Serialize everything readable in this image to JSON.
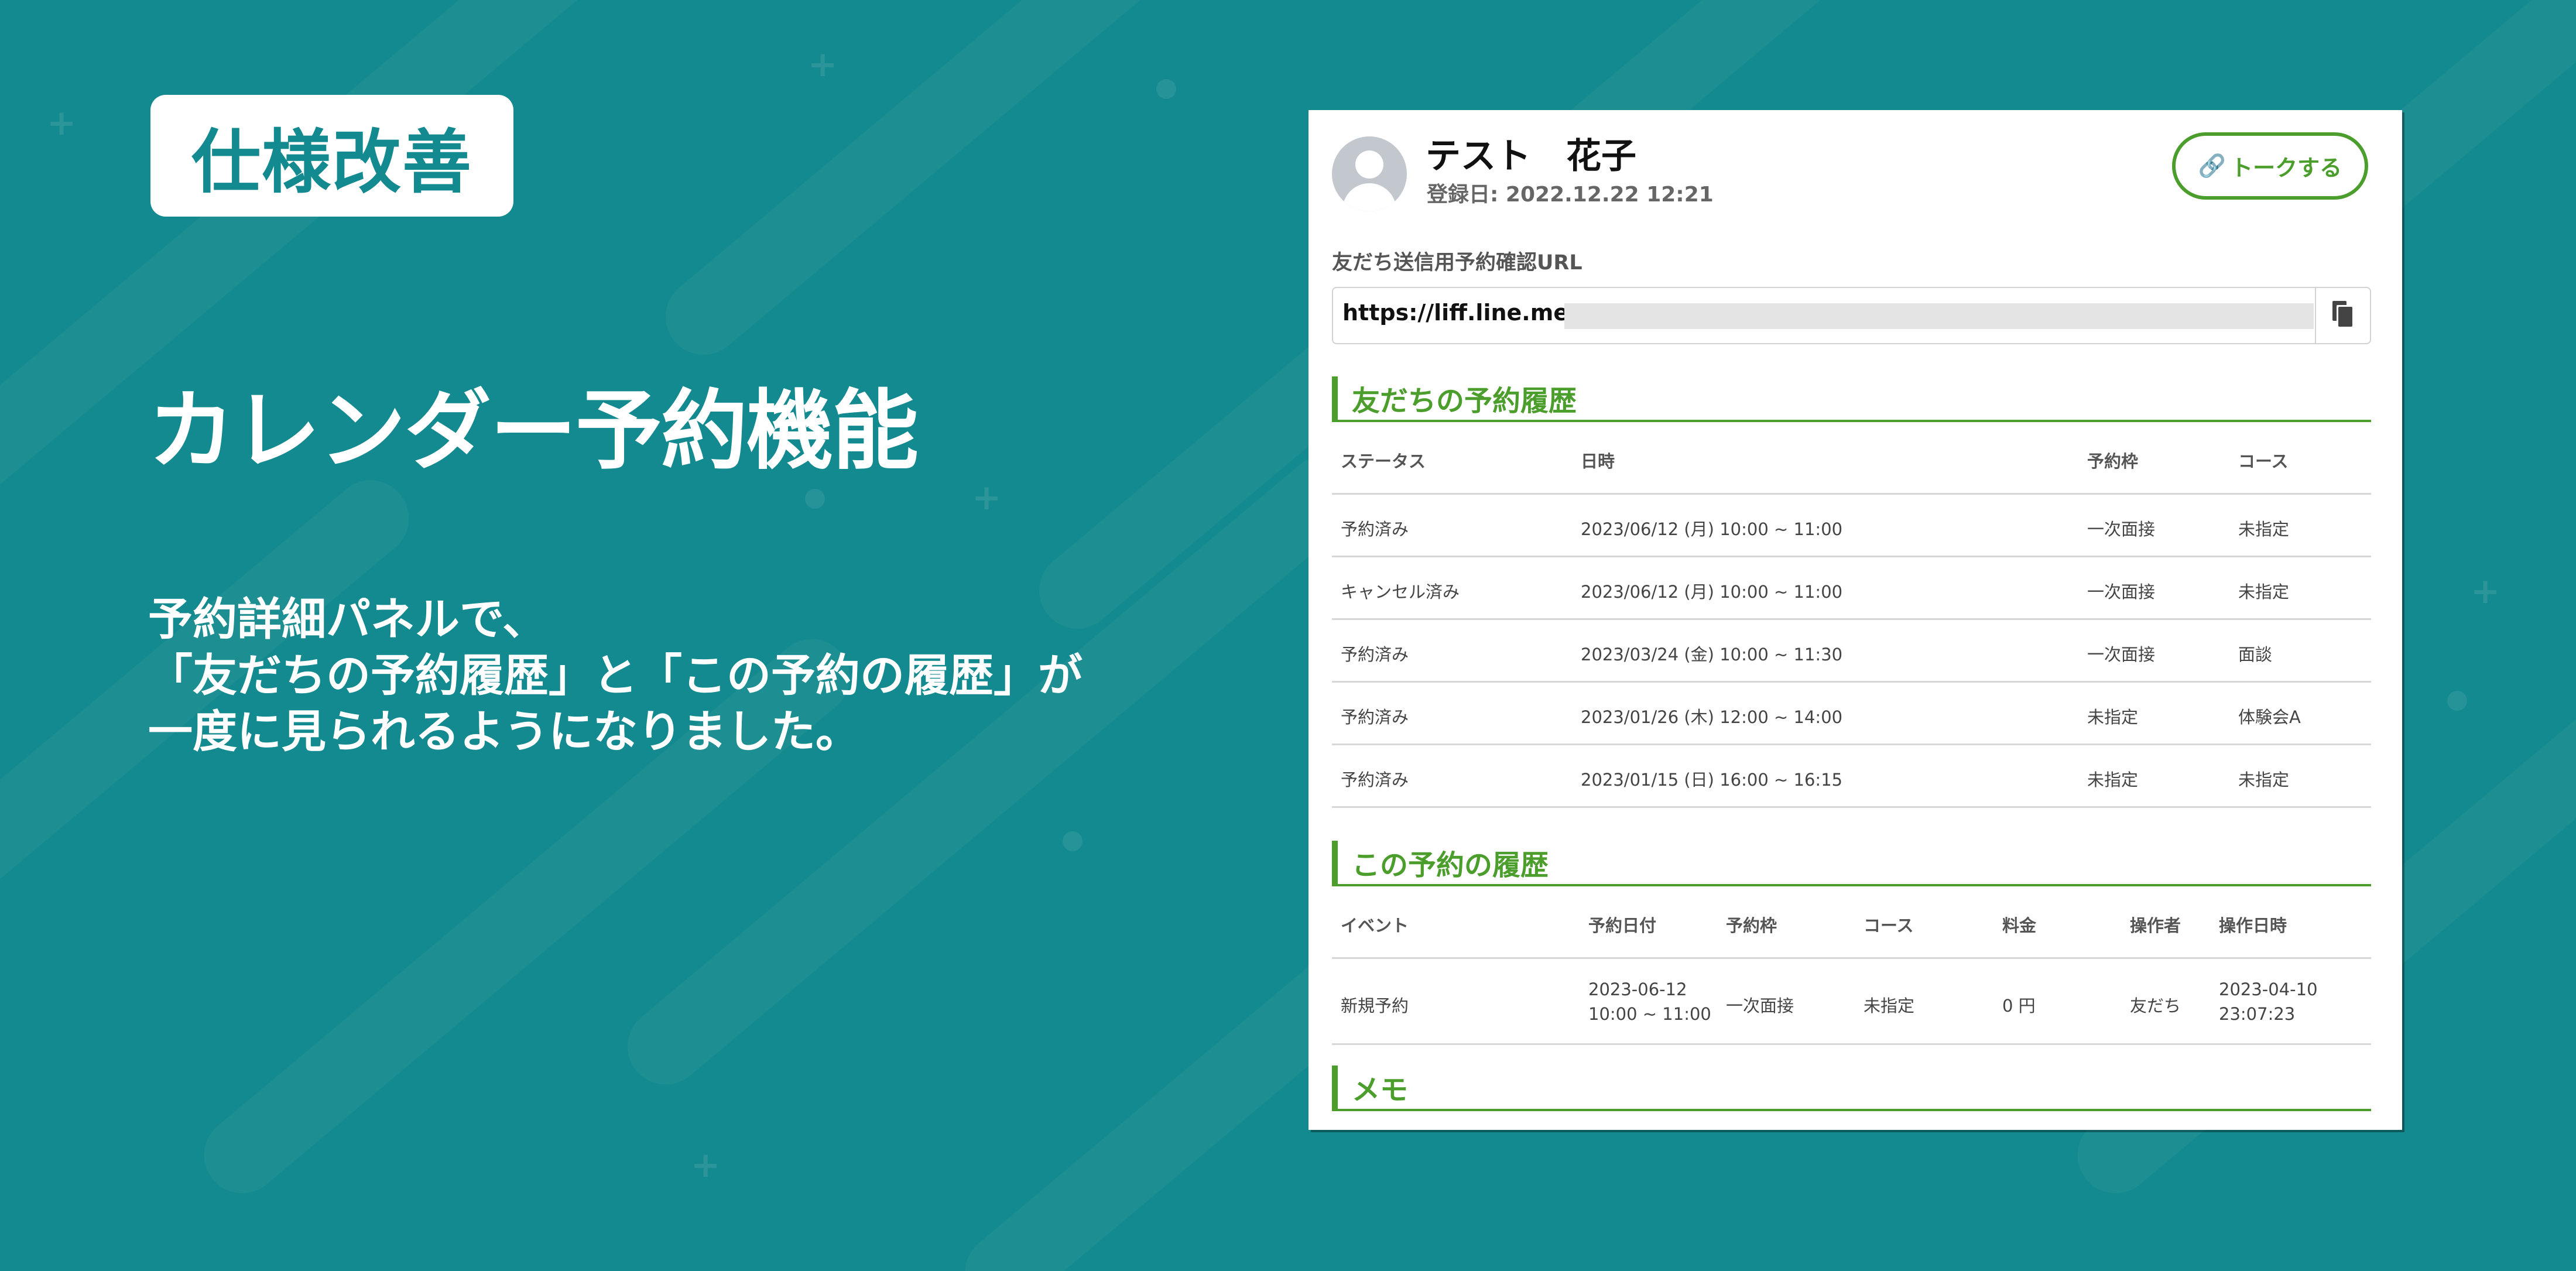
{
  "slide": {
    "badge": "仕様改善",
    "headline": "カレンダー予約機能",
    "description": [
      "予約詳細パネルで、",
      "「友だちの予約履歴」と「この予約の履歴」が",
      "一度に見られるようになりました。"
    ]
  },
  "panel": {
    "user": {
      "name": "テスト　花子",
      "registered": "登録日: 2022.12.22 12:21",
      "avatar_icon": "user-silhouette-icon"
    },
    "talk_button": {
      "icon": "link-icon",
      "label": "トークする"
    },
    "url": {
      "label": "友だち送信用予約確認URL",
      "value": "https://liff.line.me/",
      "copy_icon": "copy-icon"
    },
    "reservation_history": {
      "title": "友だちの予約履歴",
      "headers": [
        "ステータス",
        "日時",
        "予約枠",
        "コース"
      ],
      "rows": [
        [
          "予約済み",
          "2023/06/12 (月) 10:00 ~ 11:00",
          "一次面接",
          "未指定"
        ],
        [
          "キャンセル済み",
          "2023/06/12 (月) 10:00 ~ 11:00",
          "一次面接",
          "未指定"
        ],
        [
          "予約済み",
          "2023/03/24 (金) 10:00 ~ 11:30",
          "一次面接",
          "面談"
        ],
        [
          "予約済み",
          "2023/01/26 (木) 12:00 ~ 14:00",
          "未指定",
          "体験会A"
        ],
        [
          "予約済み",
          "2023/01/15 (日) 16:00 ~ 16:15",
          "未指定",
          "未指定"
        ]
      ]
    },
    "this_history": {
      "title": "この予約の履歴",
      "headers": [
        "イベント",
        "予約日付",
        "予約枠",
        "コース",
        "料金",
        "操作者",
        "操作日時"
      ],
      "row": {
        "event": "新規予約",
        "date_line1": "2023-06-12",
        "date_line2": "10:00 ~ 11:00",
        "slot": "一次面接",
        "course": "未指定",
        "fee": "0 円",
        "operator": "友だち",
        "op_line1": "2023-04-10",
        "op_line2": "23:07:23"
      }
    },
    "memo": {
      "title": "メモ"
    }
  },
  "colors": {
    "background": "#138a8f",
    "accent_green": "#4c9e2c",
    "badge_text": "#138a8f"
  }
}
